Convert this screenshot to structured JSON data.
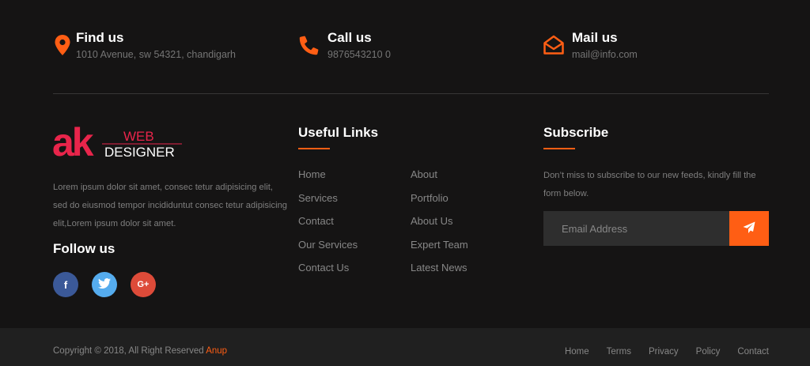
{
  "colors": {
    "accent": "#ff5e14",
    "background": "#151414",
    "bottom_bar": "#202020"
  },
  "contact": [
    {
      "title": "Find us",
      "detail": "1010 Avenue, sw 54321, chandigarh",
      "icon": "map-marker-icon"
    },
    {
      "title": "Call us",
      "detail": "9876543210 0",
      "icon": "phone-icon"
    },
    {
      "title": "Mail us",
      "detail": "mail@info.com",
      "icon": "envelope-open-icon"
    }
  ],
  "logo": {
    "mark": "ak",
    "line1": "WEB",
    "line2": "DESIGNER"
  },
  "about": {
    "text": "Lorem ipsum dolor sit amet, consec tetur adipisicing elit, sed do eiusmod tempor incididuntut consec tetur adipisicing elit,Lorem ipsum dolor sit amet."
  },
  "follow": {
    "title": "Follow us",
    "networks": [
      "f",
      "twitter",
      "G+"
    ]
  },
  "useful_links": {
    "title": "Useful Links",
    "items": [
      "Home",
      "About",
      "Services",
      "Portfolio",
      "Contact",
      "About Us",
      "Our Services",
      "Expert Team",
      "Contact Us",
      "Latest News"
    ]
  },
  "subscribe": {
    "title": "Subscribe",
    "text": "Don’t miss to subscribe to our new feeds, kindly fill the form below.",
    "placeholder": "Email Address"
  },
  "bottom": {
    "copyright": "Copyright © 2018, All Right Reserved",
    "author": "Anup",
    "menu": [
      "Home",
      "Terms",
      "Privacy",
      "Policy",
      "Contact"
    ]
  }
}
